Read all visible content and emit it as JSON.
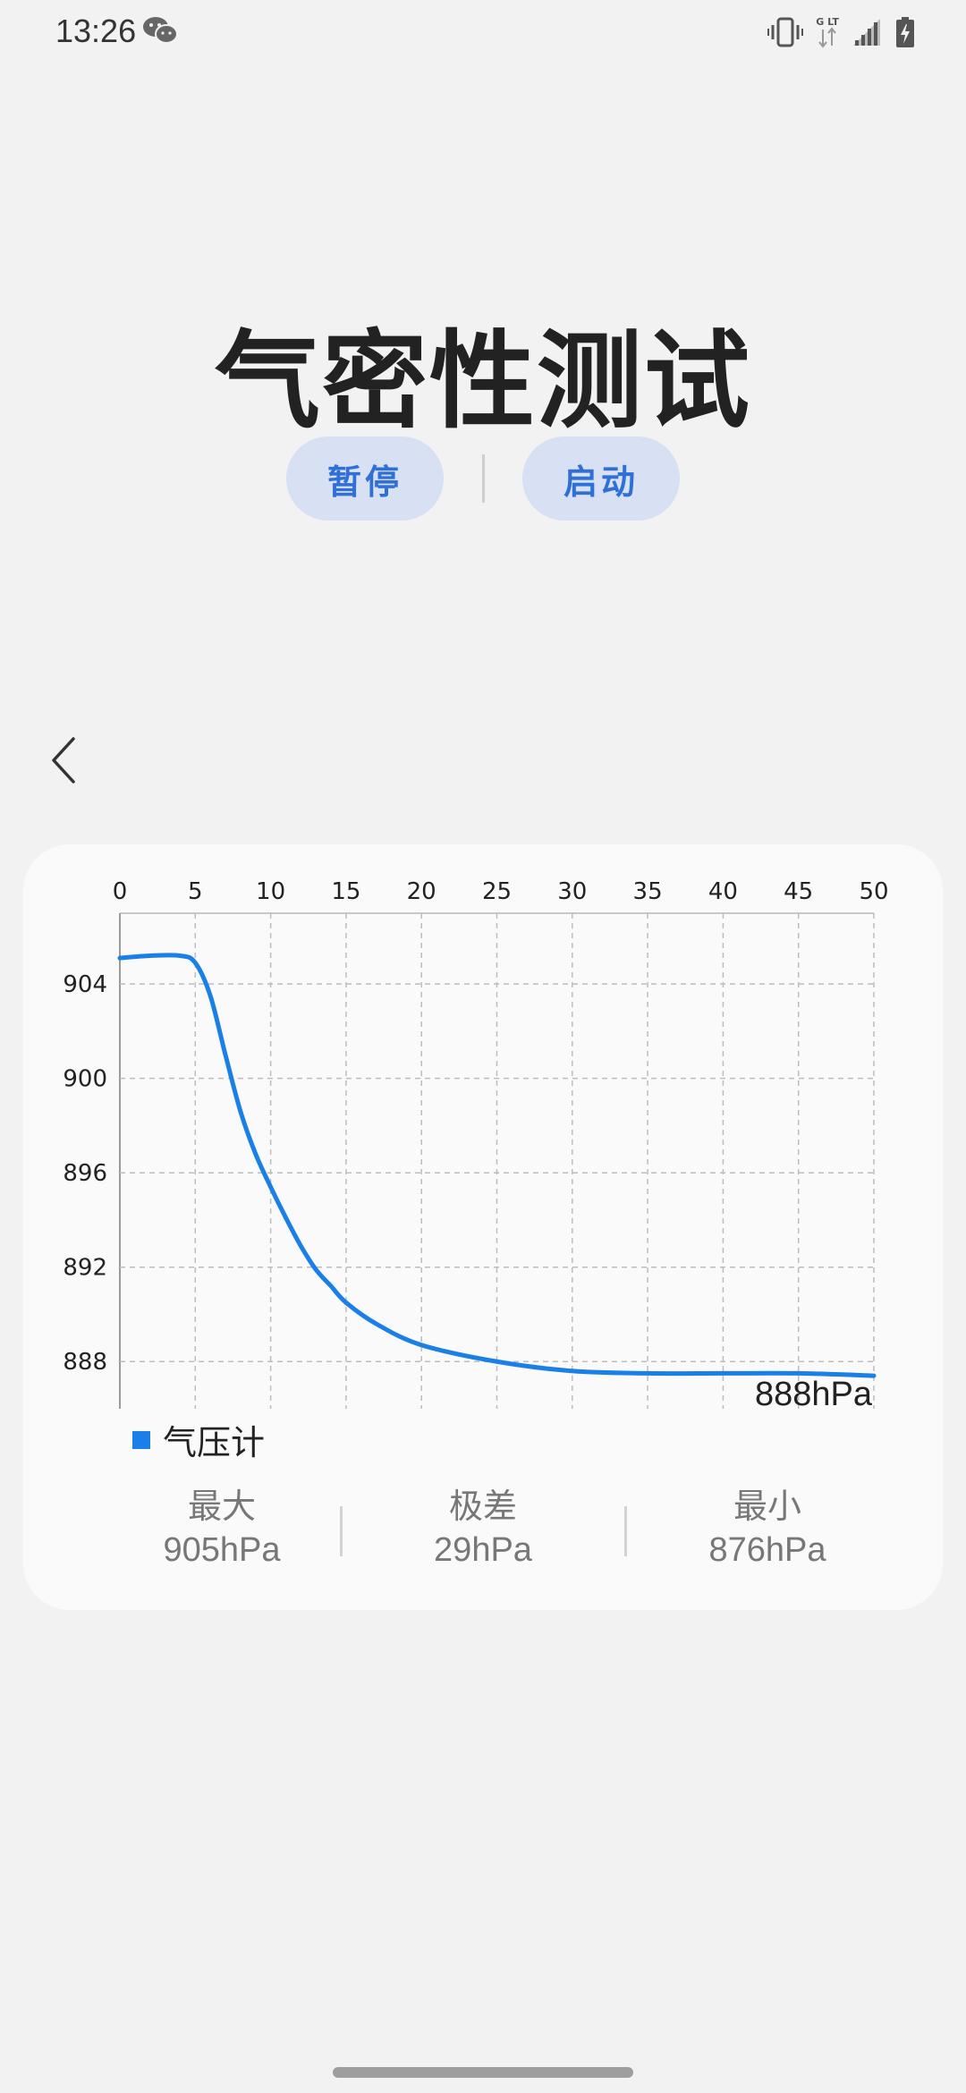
{
  "status_bar": {
    "time": "13:26",
    "network": "4G LTE"
  },
  "title": "气密性测试",
  "buttons": {
    "pause": "暂停",
    "start": "启动"
  },
  "chart_data": {
    "type": "line",
    "x_ticks": [
      0,
      5,
      10,
      15,
      20,
      25,
      30,
      35,
      40,
      45,
      50
    ],
    "y_ticks": [
      904,
      900,
      896,
      892,
      888
    ],
    "xlim": [
      0,
      50
    ],
    "ylim": [
      886,
      907
    ],
    "grid": true,
    "series": [
      {
        "name": "气压计",
        "color": "#1a7fe6",
        "x": [
          0,
          2,
          4,
          5,
          6,
          7,
          8,
          9,
          10,
          11,
          12,
          13,
          14,
          15,
          17,
          20,
          25,
          30,
          35,
          40,
          45,
          50
        ],
        "y": [
          905.1,
          905.2,
          905.2,
          904.9,
          903.5,
          901.0,
          898.6,
          896.8,
          895.4,
          894.1,
          892.9,
          891.9,
          891.2,
          890.5,
          889.6,
          888.7,
          888.0,
          887.6,
          887.5,
          887.5,
          887.5,
          887.4
        ]
      }
    ],
    "current_value_label": "888hPa",
    "legend_position": "bottom-left"
  },
  "stats": {
    "max_label": "最大",
    "max_value": "905hPa",
    "range_label": "极差",
    "range_value": "29hPa",
    "min_label": "最小",
    "min_value": "876hPa"
  }
}
